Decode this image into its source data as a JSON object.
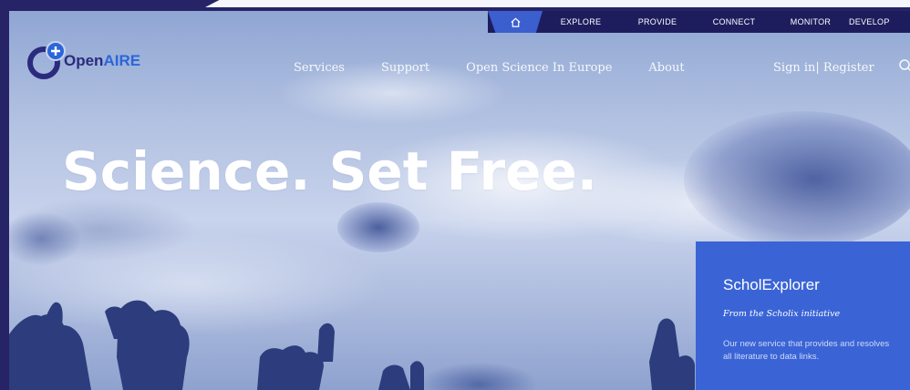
{
  "top_nav": {
    "items": [
      "EXPLORE",
      "PROVIDE",
      "CONNECT",
      "MONITOR",
      "DEVELOP"
    ]
  },
  "logo": {
    "prefix": "Open",
    "suffix": "AIRE"
  },
  "main_nav": {
    "items": [
      "Services",
      "Support",
      "Open Science In Europe",
      "About"
    ],
    "signin": "Sign in| Register"
  },
  "hero": {
    "headline": "Science. Set Free."
  },
  "card": {
    "title": "ScholExplorer",
    "subtitle": "From the Scholix initiative",
    "description": "Our new service that provides and resolves all literature to data links."
  },
  "colors": {
    "accent": "#3a64d6",
    "dark_nav": "#1d1d5e",
    "logo_dark": "#2b2b7e",
    "frame": "#262466"
  }
}
